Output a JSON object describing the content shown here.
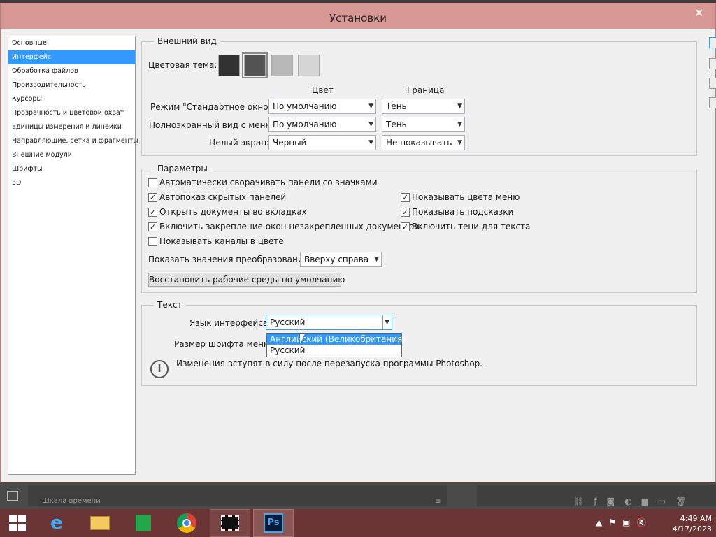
{
  "window": {
    "title": "Установки",
    "close": "✕"
  },
  "nav": {
    "items": [
      "Основные",
      "Интерфейс",
      "Обработка файлов",
      "Производительность",
      "Курсоры",
      "Прозрачность и цветовой охват",
      "Единицы измерения и линейки",
      "Направляющие, сетка и фрагменты",
      "Внешние модули",
      "Шрифты",
      "3D"
    ],
    "selected": "Интерфейс"
  },
  "appearance": {
    "group_title": "Внешний вид",
    "color_theme_label": "Цветовая тема:",
    "theme_colors": [
      "#323232",
      "#535353",
      "#b8b8b8",
      "#d6d6d6"
    ],
    "col_color": "Цвет",
    "col_border": "Граница",
    "rows": [
      {
        "label": "Режим \"Стандартное окно\":",
        "color": "По умолчанию",
        "border": "Тень"
      },
      {
        "label": "Полноэкранный вид с меню:",
        "color": "По умолчанию",
        "border": "Тень"
      },
      {
        "label": "Целый экран:",
        "color": "Черный",
        "border": "Не показывать"
      }
    ]
  },
  "params": {
    "group_title": "Параметры",
    "checkboxes": [
      {
        "label": "Автоматически сворачивать панели со значками",
        "checked": false
      },
      {
        "label": "Автопоказ скрытых панелей",
        "checked": true
      },
      {
        "label": "Открыть документы во вкладках",
        "checked": true
      },
      {
        "label": "Включить закрепление окон незакрепленных документов",
        "checked": true
      },
      {
        "label": "Показывать каналы в цвете",
        "checked": false
      },
      {
        "label": "Показывать цвета меню",
        "checked": true
      },
      {
        "label": "Показывать подсказки",
        "checked": true
      },
      {
        "label": "Включить тени для текста",
        "checked": true
      }
    ],
    "transform_label": "Показать значения преобразования:",
    "transform_value": "Вверху справа",
    "restore_button": "Восстановить рабочие среды по умолчанию"
  },
  "text": {
    "group_title": "Текст",
    "lang_label": "Язык интерфейса:",
    "lang_value": "Русский",
    "font_size_label": "Размер шрифта меню:",
    "dropdown_options": [
      "Английский (Великобритания)",
      "Русский"
    ],
    "dropdown_highlighted": "Английский (Великобритания)",
    "info_text": "Изменения вступят в силу после перезапуска программы Photoshop."
  },
  "timeline": {
    "tab_label": "Шкала времени"
  },
  "taskbar": {
    "apps": [
      "Internet Explorer",
      "File Explorer",
      "Store",
      "Chrome",
      "Video",
      "Photoshop"
    ],
    "ps_label": "Ps",
    "time": "4:49 AM",
    "date": "4/17/2023"
  },
  "colors": {
    "titlebar": "#d79895",
    "selection": "#3399ff",
    "taskbar": "#6b3535"
  }
}
